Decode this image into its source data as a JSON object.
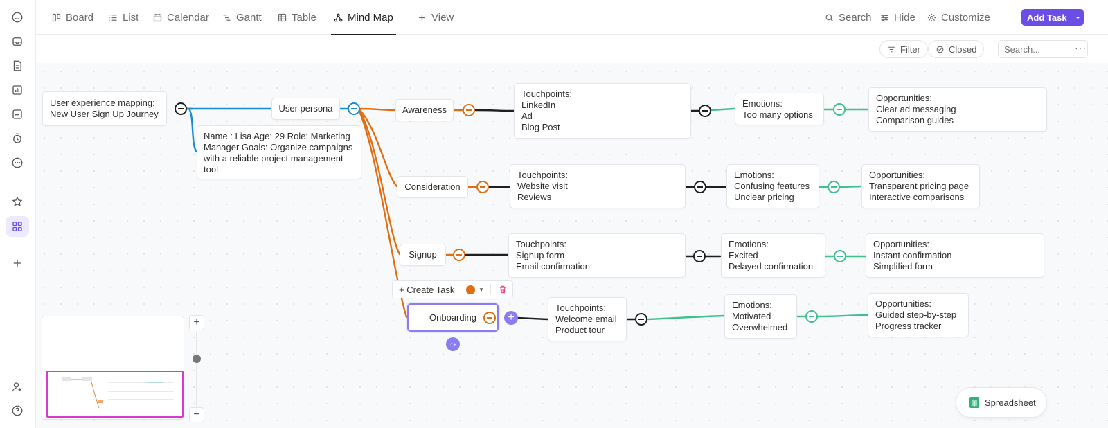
{
  "rail": {
    "items": [
      "home-icon",
      "inbox-icon",
      "docs-icon",
      "dashboards-icon",
      "whiteboards-icon",
      "timer-icon",
      "more-icon",
      "favorites-icon",
      "spaces-icon",
      "add-icon",
      "invite-icon",
      "help-icon"
    ]
  },
  "views": {
    "tabs": [
      {
        "label": "Board",
        "icon": "board-icon"
      },
      {
        "label": "List",
        "icon": "list-icon"
      },
      {
        "label": "Calendar",
        "icon": "calendar-icon"
      },
      {
        "label": "Gantt",
        "icon": "gantt-icon"
      },
      {
        "label": "Table",
        "icon": "table-icon"
      },
      {
        "label": "Mind Map",
        "icon": "mindmap-icon",
        "active": true
      }
    ],
    "add_view_label": "View"
  },
  "toolbar": {
    "search_label": "Search",
    "hide_label": "Hide",
    "customize_label": "Customize",
    "add_task_label": "Add Task",
    "accent": "#6b4ee6"
  },
  "filters": {
    "filter_label": "Filter",
    "closed_label": "Closed",
    "search_placeholder": "Search..."
  },
  "mindmap": {
    "root": "User experience mapping:\nNew User Sign Up Journey",
    "persona": "User persona",
    "persona_details": "Name : Lisa Age: 29 Role: Marketing\nManager Goals: Organize campaigns\nwith a reliable project management\ntool",
    "stages": [
      {
        "name": "Awareness",
        "touchpoints": "Touchpoints:\nLinkedIn\nAd\nBlog Post",
        "emotions": "Emotions:\nToo many options",
        "opportunities": "Opportunities:\nClear ad messaging\nComparison guides"
      },
      {
        "name": "Consideration",
        "touchpoints": "Touchpoints:\nWebsite visit\nReviews",
        "emotions": "Emotions:\nConfusing features\nUnclear pricing",
        "opportunities": "Opportunities:\nTransparent pricing page\nInteractive comparisons"
      },
      {
        "name": "Signup",
        "touchpoints": "Touchpoints:\nSignup form\nEmail confirmation",
        "emotions": "Emotions:\nExcited\nDelayed confirmation",
        "opportunities": "Opportunities:\nInstant confirmation\nSimplified form"
      },
      {
        "name": "Onboarding",
        "touchpoints": "Touchpoints:\nWelcome email\nProduct tour",
        "emotions": "Emotions:\nMotivated\nOverwhelmed",
        "opportunities": "Opportunities:\nGuided step-by-step\nProgress tracker"
      }
    ],
    "colors": {
      "root_link": "#1a8ad4",
      "stage_link": "#e06f14",
      "task_link": "#1f1f1f",
      "detail_link": "#3fc08c",
      "selected": "#8b7cf2"
    }
  },
  "node_toolbar": {
    "create_task_label": "+ Create Task",
    "status_color": "#e06f14"
  },
  "zoom": {
    "plus": "+",
    "minus": "−"
  },
  "spreadsheet_label": "Spreadsheet"
}
